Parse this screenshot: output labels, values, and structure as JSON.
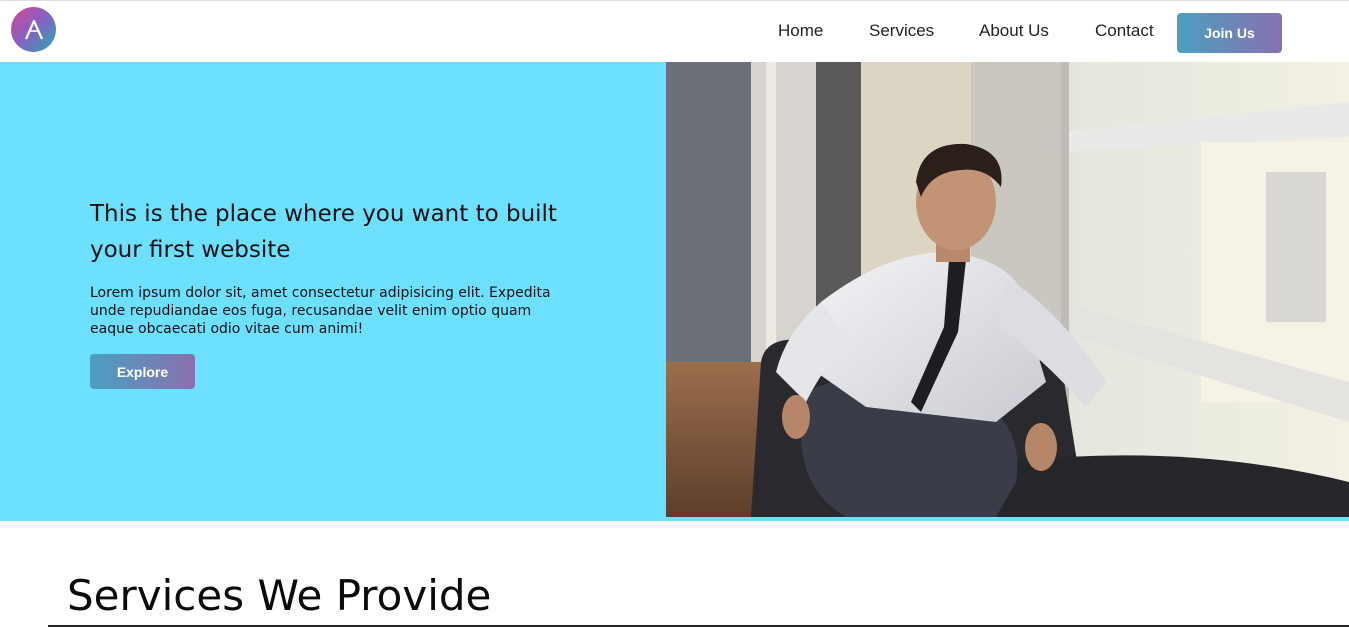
{
  "header": {
    "logo_icon": "a-letter-logo-icon",
    "nav": {
      "home": "Home",
      "services": "Services",
      "about": "About Us",
      "contact": "Contact"
    },
    "join_label": "Join Us"
  },
  "hero": {
    "title": "This is the place where you want to built your first website",
    "text": "Lorem ipsum dolor sit, amet consectetur adipisicing elit. Expedita unde repudiandae eos fuga, recusandae velit enim optio quam eaque obcaecati odio vitae cum animi!",
    "button_label": "Explore",
    "background_color": "#6ee0ff",
    "photo_icon": "businessman-photo"
  },
  "services": {
    "title": "Services We Provide"
  },
  "colors": {
    "gradient_start": "#4aa0c1",
    "gradient_end": "#8a6fb0"
  }
}
